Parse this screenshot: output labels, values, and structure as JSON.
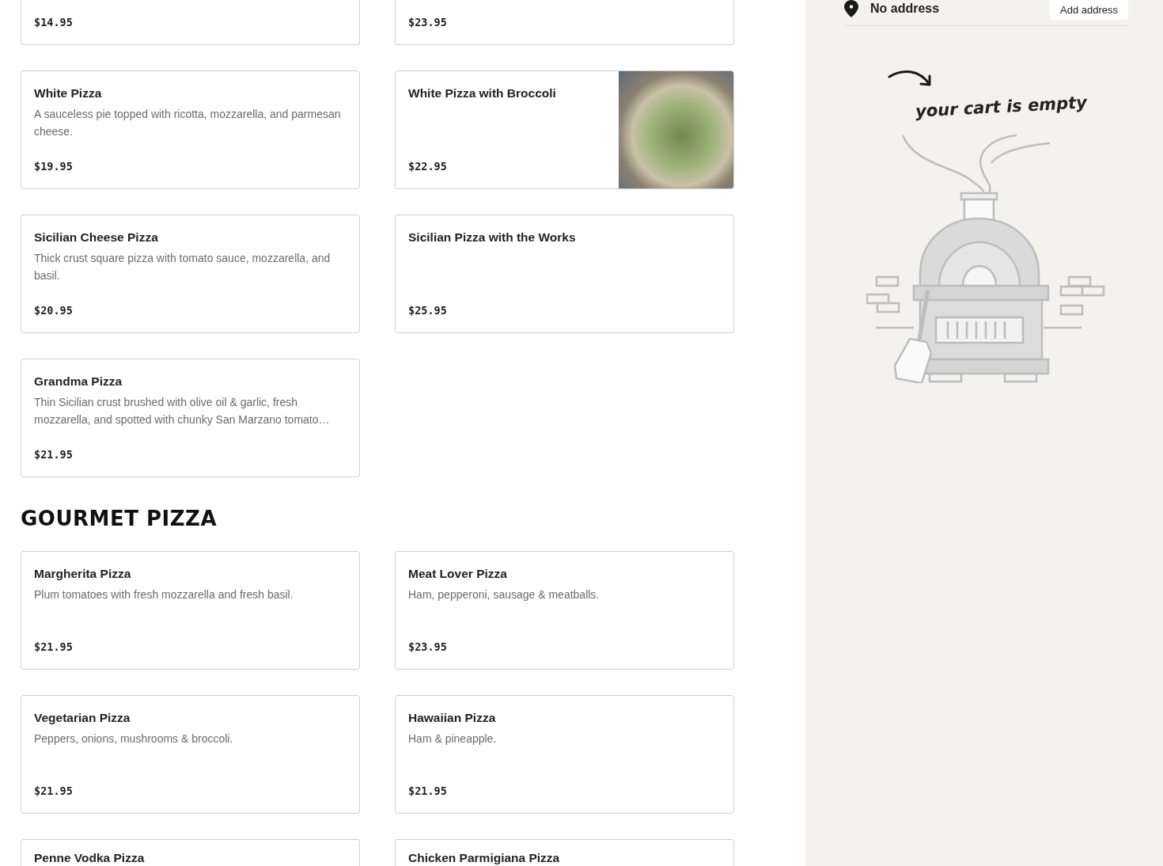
{
  "menu": {
    "sections": [
      {
        "items": [
          {
            "price": "$14.95",
            "kind": "plain"
          },
          {
            "price": "$23.95",
            "kind": "plain"
          },
          {
            "name": "White Pizza",
            "description": "A sauceless pie topped with ricotta, mozzarella, and parmesan cheese.",
            "price": "$19.95",
            "kind": "plain"
          },
          {
            "name": "White Pizza with Broccoli",
            "price": "$22.95",
            "kind": "photo"
          },
          {
            "name": "Sicilian Cheese Pizza",
            "description": "Thick crust square pizza with tomato sauce, mozzarella, and basil.",
            "price": "$20.95",
            "kind": "plain"
          },
          {
            "name": "Sicilian Pizza with the Works",
            "price": "$25.95",
            "kind": "plain"
          },
          {
            "name": "Grandma Pizza",
            "description": "Thin Sicilian crust brushed with olive oil & garlic, fresh mozzarella, and spotted with chunky San Marzano tomato…",
            "price": "$21.95",
            "kind": "plain"
          }
        ]
      },
      {
        "title": "GOURMET PIZZA",
        "items": [
          {
            "name": "Margherita Pizza",
            "description": "Plum tomatoes with fresh mozzarella and fresh basil.",
            "price": "$21.95",
            "kind": "plain"
          },
          {
            "name": "Meat Lover Pizza",
            "description": "Ham, pepperoni, sausage & meatballs.",
            "price": "$23.95",
            "kind": "plain"
          },
          {
            "name": "Vegetarian Pizza",
            "description": "Peppers, onions, mushrooms & broccoli.",
            "price": "$21.95",
            "kind": "plain"
          },
          {
            "name": "Hawaiian Pizza",
            "description": "Ham & pineapple.",
            "price": "$21.95",
            "kind": "plain"
          },
          {
            "name": "Penne Vodka Pizza",
            "kind": "plain"
          },
          {
            "name": "Chicken Parmigiana Pizza",
            "kind": "plain"
          }
        ]
      }
    ]
  },
  "cart": {
    "address": "No address",
    "add_address_button": "Add address",
    "empty_message": "your cart is empty"
  }
}
